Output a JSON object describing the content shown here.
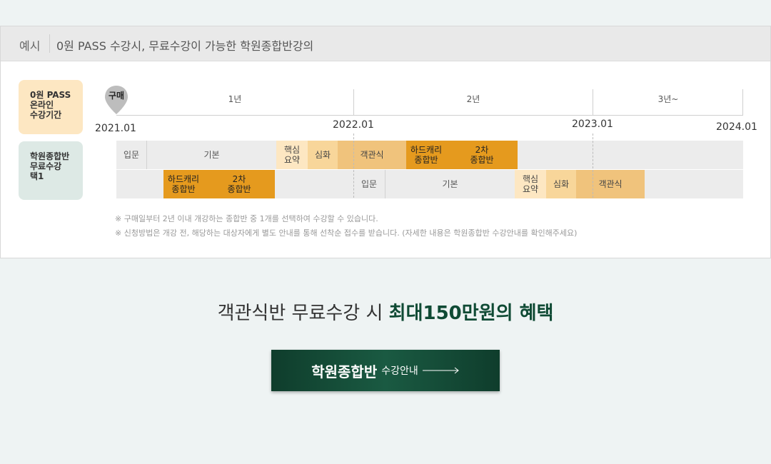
{
  "header": {
    "tag": "예시",
    "title": "0원 PASS 수강시, 무료수강이 가능한 학원종합반강의"
  },
  "badges": [
    {
      "lines": [
        "0원 PASS",
        "온라인",
        "수강기간"
      ]
    },
    {
      "lines": [
        "학원종합반",
        "무료수강",
        "택1"
      ]
    }
  ],
  "timeline": {
    "pin_label": "구매",
    "periods": [
      "1년",
      "2년",
      "3년~"
    ],
    "dates": [
      "2021.01",
      "2022.01",
      "2023.01",
      "2024.01"
    ]
  },
  "track1": [
    {
      "lines": [
        "입문"
      ]
    },
    {
      "lines": [
        "기본"
      ]
    },
    {
      "lines": [
        "핵심",
        "요약"
      ]
    },
    {
      "lines": [
        "심화"
      ]
    },
    {
      "lines": [
        "객관식"
      ]
    },
    {
      "lines": [
        "하드캐리",
        "종합반"
      ]
    },
    {
      "lines": [
        "2차",
        "종합반"
      ]
    }
  ],
  "track2": [
    {
      "lines": [
        "하드캐리",
        "종합반"
      ]
    },
    {
      "lines": [
        "2차",
        "종합반"
      ]
    },
    {
      "lines": [
        "입문"
      ]
    },
    {
      "lines": [
        "기본"
      ]
    },
    {
      "lines": [
        "핵심",
        "요약"
      ]
    },
    {
      "lines": [
        "심화"
      ]
    },
    {
      "lines": [
        "객관식"
      ]
    }
  ],
  "notes": [
    "※ 구매일부터 2년 이내 개강하는 종합반 중 1개를 선택하여 수강할 수 있습니다.",
    "※ 신청방법은 개강 전, 해당하는 대상자에게 별도 안내를 통해 선착순 접수를 받습니다. (자세한 내용은 학원종합반 수강안내를 확인해주세요)"
  ],
  "benefit": {
    "prefix": "객관식반 무료수강 시 ",
    "highlight": "최대150만원의 혜택"
  },
  "cta": {
    "strong": "학원종합반",
    "light": "수강안내"
  },
  "colors": {
    "accent": "#0f4a34",
    "button": "#134a36",
    "dark_orange": "#e59a1e",
    "tan": "#f0c37c",
    "light_peach": "#fde7c2",
    "mint": "#dde9e5"
  }
}
